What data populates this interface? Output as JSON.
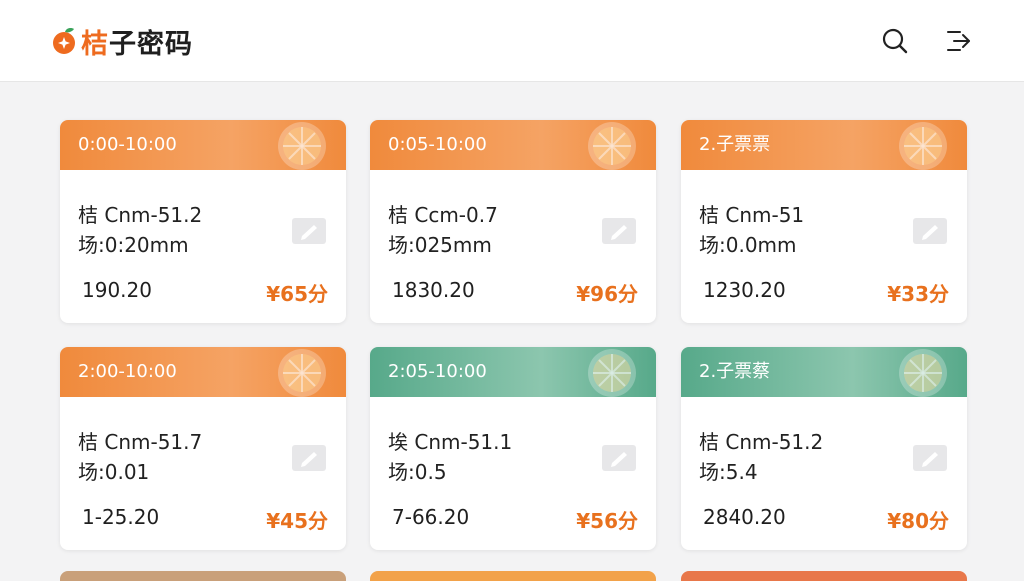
{
  "app": {
    "logo_first": "桔",
    "logo_rest": "子密码"
  },
  "header": {
    "search_icon": "search-icon",
    "exit_icon": "logout-icon"
  },
  "theme": {
    "orange": "#f08a3c",
    "orange_light": "#f5a364",
    "teal": "#57a98a",
    "price": "#e8711e"
  },
  "cards": [
    {
      "title": "0:00-10:00",
      "line1": "桔 Cnm-51.2",
      "line2": "场:0:20mm",
      "number": "190.20",
      "price": "¥65分",
      "color": "orange"
    },
    {
      "title": "0:05-10:00",
      "line1": "桔 Ccm-0.7",
      "line2": "场:025mm",
      "number": "1830.20",
      "price": "¥96分",
      "color": "orange"
    },
    {
      "title": "2.子票票",
      "line1": "桔 Cnm-51",
      "line2": "场:0.0mm",
      "number": "1230.20",
      "price": "¥33分",
      "color": "orange"
    },
    {
      "title": "2:00-10:00",
      "line1": "桔 Cnm-51.7",
      "line2": "场:0.01",
      "number": "1-25.20",
      "price": "¥45分",
      "color": "orange"
    },
    {
      "title": "2:05-10:00",
      "line1": "埃 Cnm-51.1",
      "line2": "场:0.5",
      "number": "7-66.20",
      "price": "¥56分",
      "color": "teal"
    },
    {
      "title": "2.子票蔡",
      "line1": "桔 Cnm-51.2",
      "line2": "场:5.4",
      "number": "2840.20",
      "price": "¥80分",
      "color": "teal"
    }
  ]
}
